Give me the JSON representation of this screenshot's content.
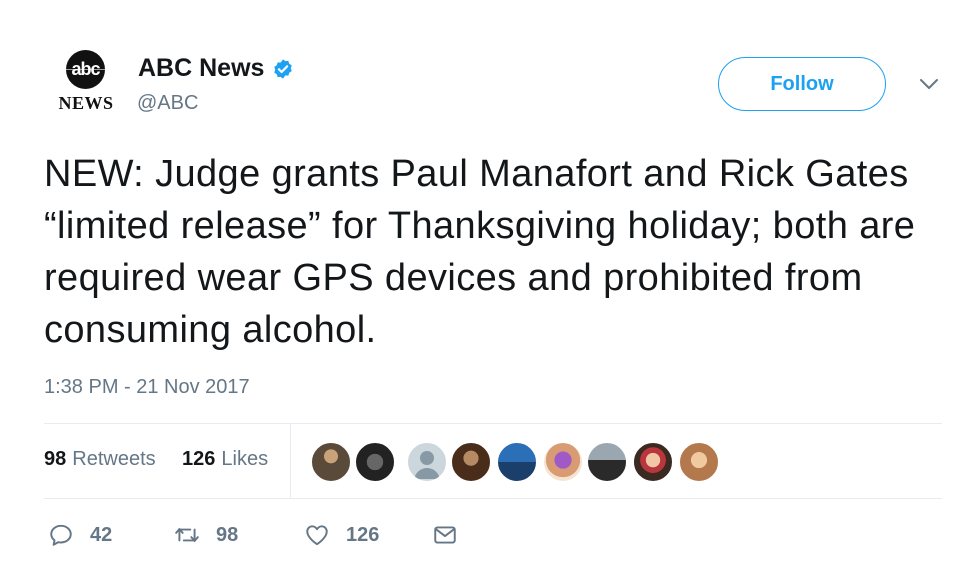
{
  "account": {
    "logo_top": "abc",
    "logo_bottom": "NEWS",
    "name": "ABC News",
    "handle": "@ABC",
    "verified": true,
    "follow_label": "Follow"
  },
  "tweet": {
    "text": "NEW: Judge grants Paul Manafort and Rick Gates “limited release” for Thanksgiving holiday; both are required wear GPS devices and prohibited from consuming alcohol.",
    "timestamp": "1:38 PM - 21 Nov 2017"
  },
  "stats": {
    "retweets_count": "98",
    "retweets_label": "Retweets",
    "likes_count": "126",
    "likes_label": "Likes"
  },
  "actions": {
    "reply_count": "42",
    "retweet_count": "98",
    "like_count": "126"
  },
  "icons": [
    "verified-badge-icon",
    "chevron-down-icon",
    "reply-icon",
    "retweet-icon",
    "heart-icon",
    "message-icon"
  ],
  "colors": {
    "accent": "#1da1f2",
    "text": "#14171a",
    "secondary": "#657786",
    "divider": "#e6ecf0"
  }
}
